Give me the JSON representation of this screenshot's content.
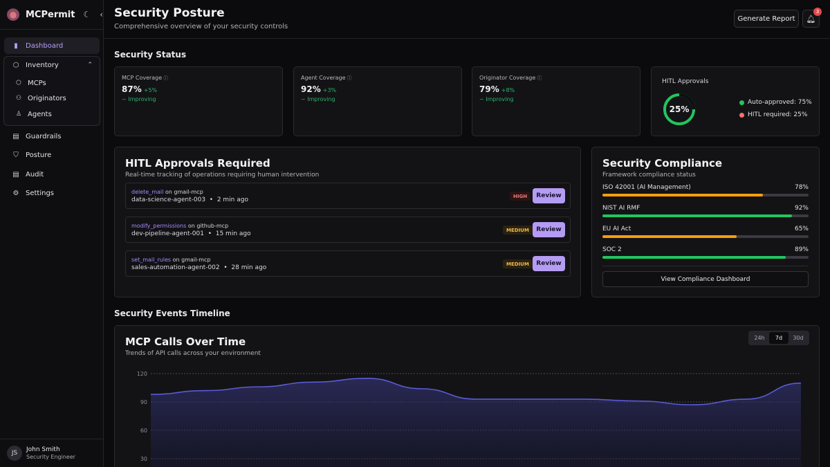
{
  "app": {
    "name": "MCPermit"
  },
  "sidebar": {
    "items": [
      {
        "label": "Dashboard",
        "icon": "bar-chart-icon"
      },
      {
        "label": "Inventory",
        "icon": "box-icon"
      },
      {
        "label": "Guardrails",
        "icon": "document-icon"
      },
      {
        "label": "Posture",
        "icon": "shield-icon"
      },
      {
        "label": "Audit",
        "icon": "clipboard-icon"
      },
      {
        "label": "Settings",
        "icon": "gear-icon"
      }
    ],
    "inventory_sub": [
      {
        "label": "MCPs",
        "icon": "cube-icon"
      },
      {
        "label": "Originators",
        "icon": "users-icon"
      },
      {
        "label": "Agents",
        "icon": "user-icon"
      }
    ]
  },
  "user": {
    "initials": "JS",
    "name": "John Smith",
    "role": "Security Engineer"
  },
  "header": {
    "title": "Security Posture",
    "subtitle": "Comprehensive overview of your security controls",
    "generate_label": "Generate Report",
    "notification_count": "3"
  },
  "security_status": {
    "title": "Security Status",
    "coverage": [
      {
        "label": "MCP Coverage",
        "value": "87%",
        "delta": "+5%",
        "trend": "~ Improving"
      },
      {
        "label": "Agent Coverage",
        "value": "92%",
        "delta": "+3%",
        "trend": "~ Improving"
      },
      {
        "label": "Originator Coverage",
        "value": "79%",
        "delta": "+8%",
        "trend": "~ Improving"
      }
    ],
    "hitl": {
      "title": "HITL Approvals",
      "percent": "25%",
      "fraction": 0.25,
      "auto_label": "Auto-approved: 75%",
      "required_label": "HITL required: 25%",
      "auto_color": "#22c55e",
      "required_color": "#f87171"
    }
  },
  "approvals": {
    "title": "HITL Approvals Required",
    "subtitle": "Real-time tracking of operations requiring human intervention",
    "review_label": "Review",
    "on_label": "on",
    "rows": [
      {
        "fn": "delete_mail",
        "server": "gmail-mcp",
        "agent": "data-science-agent-003",
        "time": "2 min ago",
        "severity": "HIGH"
      },
      {
        "fn": "modify_permissions",
        "server": "github-mcp",
        "agent": "dev-pipeline-agent-001",
        "time": "15 min ago",
        "severity": "MEDIUM"
      },
      {
        "fn": "set_mail_rules",
        "server": "gmail-mcp",
        "agent": "sales-automation-agent-002",
        "time": "28 min ago",
        "severity": "MEDIUM"
      }
    ]
  },
  "compliance": {
    "title": "Security Compliance",
    "subtitle": "Framework compliance status",
    "button_label": "View Compliance Dashboard",
    "frameworks": [
      {
        "name": "ISO 42001 (AI Management)",
        "pct": "78%",
        "value": 78,
        "color": "#f59e0b"
      },
      {
        "name": "NIST AI RMF",
        "pct": "92%",
        "value": 92,
        "color": "#22c55e"
      },
      {
        "name": "EU AI Act",
        "pct": "65%",
        "value": 65,
        "color": "#f59e0b"
      },
      {
        "name": "SOC 2",
        "pct": "89%",
        "value": 89,
        "color": "#22c55e"
      }
    ]
  },
  "timeline": {
    "section_title": "Security Events Timeline",
    "card_title": "MCP Calls Over Time",
    "card_subtitle": "Trends of API calls across your environment",
    "ranges": [
      "24h",
      "7d",
      "30d"
    ],
    "active_range": "7d"
  },
  "chart_data": {
    "type": "area",
    "title": "MCP Calls Over Time",
    "yticks": [
      120,
      90,
      60,
      30
    ],
    "ylim": [
      0,
      120
    ],
    "values": [
      98,
      102,
      106,
      111,
      115,
      104,
      93,
      93,
      93,
      91,
      87,
      93,
      110
    ],
    "grid": true,
    "line_color": "#5b5bd6"
  }
}
